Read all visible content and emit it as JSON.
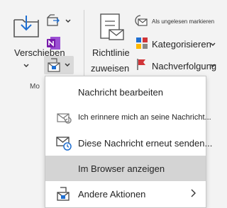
{
  "ribbon": {
    "move": {
      "label": "Verschieben",
      "group_label": "Mo"
    },
    "rules": {
      "label_line1": "Richtlinie",
      "label_line2": "zuweisen"
    },
    "tags": {
      "mark_unread": "Als ungelesen markieren",
      "categorize": "Kategorisieren",
      "followup": "Nachverfolgung"
    }
  },
  "menu": {
    "items": [
      {
        "label": "Nachricht bearbeiten",
        "icon": "none",
        "small": false,
        "highlighted": false,
        "submenu": false
      },
      {
        "label": "Ich erinnere mich an seine Nachricht...",
        "icon": "recall-icon",
        "small": true,
        "highlighted": false,
        "submenu": false
      },
      {
        "label": "Diese Nachricht erneut senden...",
        "icon": "resend-icon",
        "small": false,
        "highlighted": false,
        "submenu": false
      },
      {
        "label": "Im Browser anzeigen",
        "icon": "none",
        "small": false,
        "highlighted": true,
        "submenu": false
      },
      {
        "label": "Andere Aktionen",
        "icon": "other-actions-icon",
        "small": false,
        "highlighted": false,
        "submenu": true
      }
    ]
  },
  "colors": {
    "accent_blue": "#1f6fd1",
    "onenote_purple": "#7719aa",
    "flag_red": "#d13438",
    "highlight": "#d4d4d4"
  }
}
